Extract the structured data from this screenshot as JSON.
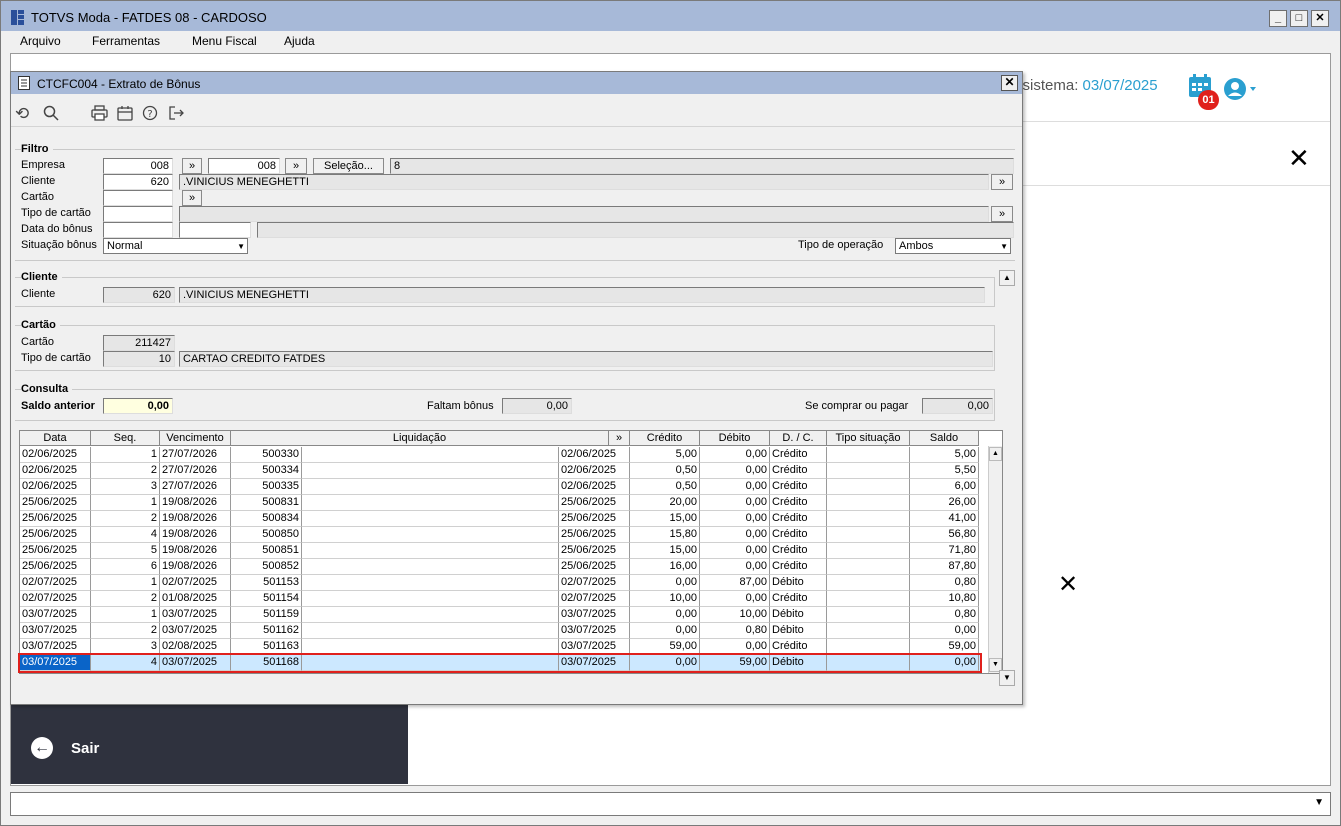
{
  "window": {
    "title": "TOTVS Moda - FATDES 08 - CARDOSO"
  },
  "menu": [
    "Arquivo",
    "Ferramentas",
    "Menu Fiscal",
    "Ajuda"
  ],
  "app": {
    "system_date_prefix": "o sistema:",
    "system_date": "03/07/2025",
    "badge": "01",
    "exit_label": "Sair"
  },
  "dialog": {
    "title": "CTCFC004 - Extrato de Bônus",
    "filter": {
      "section": "Filtro",
      "empresa_label": "Empresa",
      "empresa_from": "008",
      "empresa_to": "008",
      "selection_button": "Seleção...",
      "selection_value": "8",
      "cliente_label": "Cliente",
      "cliente_code": "620",
      "cliente_name": ".VINICIUS MENEGHETTI",
      "cartao_label": "Cartão",
      "tipo_cartao_label": "Tipo de cartão",
      "data_bonus_label": "Data do bônus",
      "situacao_label": "Situação bônus",
      "situacao_value": "Normal",
      "tipo_operacao_label": "Tipo de operação",
      "tipo_operacao_value": "Ambos",
      "arrow": "»"
    },
    "cliente": {
      "section": "Cliente",
      "label": "Cliente",
      "code": "620",
      "name": ".VINICIUS MENEGHETTI"
    },
    "cartao": {
      "section": "Cartão",
      "cartao_label": "Cartão",
      "cartao_value": "211427",
      "tipo_label": "Tipo de cartão",
      "tipo_code": "10",
      "tipo_name": "CARTAO CREDITO FATDES"
    },
    "consulta": {
      "section": "Consulta",
      "saldo_anterior_label": "Saldo anterior",
      "saldo_anterior_value": "0,00",
      "faltam_label": "Faltam bônus",
      "faltam_value": "0,00",
      "se_comprar_label": "Se comprar ou pagar",
      "se_comprar_value": "0,00"
    },
    "grid": {
      "columns": [
        "Data",
        "Seq.",
        "Vencimento",
        "Liquidação",
        "»",
        "Crédito",
        "Débito",
        "D. / C.",
        "Tipo situação",
        "Saldo"
      ],
      "rows": [
        [
          "02/06/2025",
          "1",
          "27/07/2026",
          "500330",
          "",
          "02/06/2025",
          "5,00",
          "0,00",
          "Crédito",
          "",
          "5,00"
        ],
        [
          "02/06/2025",
          "2",
          "27/07/2026",
          "500334",
          "",
          "02/06/2025",
          "0,50",
          "0,00",
          "Crédito",
          "",
          "5,50"
        ],
        [
          "02/06/2025",
          "3",
          "27/07/2026",
          "500335",
          "",
          "02/06/2025",
          "0,50",
          "0,00",
          "Crédito",
          "",
          "6,00"
        ],
        [
          "25/06/2025",
          "1",
          "19/08/2026",
          "500831",
          "",
          "25/06/2025",
          "20,00",
          "0,00",
          "Crédito",
          "",
          "26,00"
        ],
        [
          "25/06/2025",
          "2",
          "19/08/2026",
          "500834",
          "",
          "25/06/2025",
          "15,00",
          "0,00",
          "Crédito",
          "",
          "41,00"
        ],
        [
          "25/06/2025",
          "4",
          "19/08/2026",
          "500850",
          "",
          "25/06/2025",
          "15,80",
          "0,00",
          "Crédito",
          "",
          "56,80"
        ],
        [
          "25/06/2025",
          "5",
          "19/08/2026",
          "500851",
          "",
          "25/06/2025",
          "15,00",
          "0,00",
          "Crédito",
          "",
          "71,80"
        ],
        [
          "25/06/2025",
          "6",
          "19/08/2026",
          "500852",
          "",
          "25/06/2025",
          "16,00",
          "0,00",
          "Crédito",
          "",
          "87,80"
        ],
        [
          "02/07/2025",
          "1",
          "02/07/2025",
          "501153",
          "",
          "02/07/2025",
          "0,00",
          "87,00",
          "Débito",
          "",
          "0,80"
        ],
        [
          "02/07/2025",
          "2",
          "01/08/2025",
          "501154",
          "",
          "02/07/2025",
          "10,00",
          "0,00",
          "Crédito",
          "",
          "10,80"
        ],
        [
          "03/07/2025",
          "1",
          "03/07/2025",
          "501159",
          "",
          "03/07/2025",
          "0,00",
          "10,00",
          "Débito",
          "",
          "0,80"
        ],
        [
          "03/07/2025",
          "2",
          "03/07/2025",
          "501162",
          "",
          "03/07/2025",
          "0,00",
          "0,80",
          "Débito",
          "",
          "0,00"
        ],
        [
          "03/07/2025",
          "3",
          "02/08/2025",
          "501163",
          "",
          "03/07/2025",
          "59,00",
          "0,00",
          "Crédito",
          "",
          "59,00"
        ],
        [
          "03/07/2025",
          "4",
          "03/07/2025",
          "501168",
          "",
          "03/07/2025",
          "0,00",
          "59,00",
          "Débito",
          "",
          "0,00"
        ]
      ],
      "selected_row": 13
    }
  },
  "colors": {
    "title_bar": "#a7b9d8",
    "accent": "#2a9fd0",
    "badge": "#e0201c",
    "selection": "#cce8ff",
    "highlight_border": "#e0201c"
  }
}
